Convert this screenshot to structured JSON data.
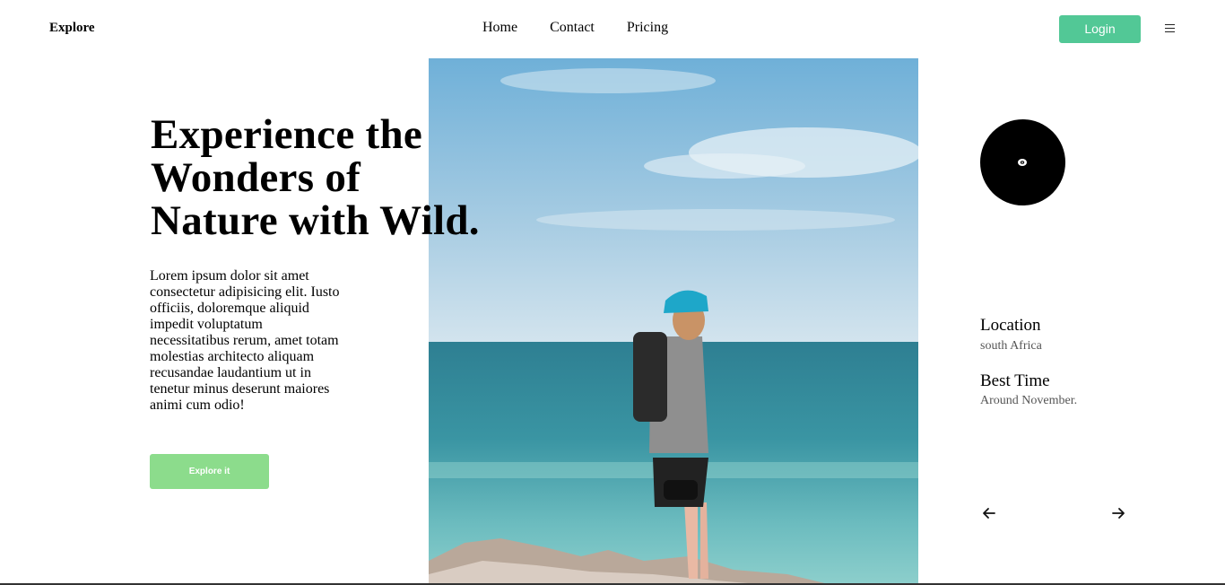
{
  "header": {
    "logo": "Explore",
    "nav": [
      "Home",
      "Contact",
      "Pricing"
    ],
    "login_label": "Login",
    "menu_icon": "hamburger-icon"
  },
  "hero": {
    "headline_lines": [
      "Experience the",
      "Wonders of",
      "Nature with Wild."
    ],
    "description": "Lorem ipsum dolor sit amet consectetur adipisicing elit. Iusto officiis, doloremque aliquid impedit voluptatum necessitatibus rerum, amet totam molestias architecto aliquam recusandae laudantium ut in tenetur minus deserunt maiores animi cum odio!",
    "cta_label": "Explore it"
  },
  "side": {
    "location_title": "Location",
    "location_value": "south Africa",
    "time_title": "Best Time",
    "time_value": "Around November.",
    "prev_icon": "arrow-left-icon",
    "next_icon": "arrow-right-icon"
  },
  "colors": {
    "accent": "#52c896",
    "cta": "#8cdc8c"
  }
}
